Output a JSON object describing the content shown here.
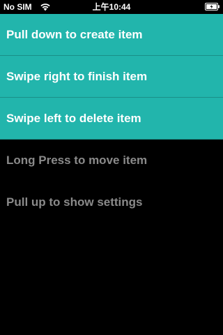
{
  "status_bar": {
    "carrier": "No SIM",
    "time": "上午10:44",
    "wifi_icon": "wifi-icon",
    "battery_icon": "battery-charging-icon"
  },
  "list": {
    "items": [
      {
        "label": "Pull down to create item",
        "state": "highlighted"
      },
      {
        "label": "Swipe right to finish item",
        "state": "highlighted"
      },
      {
        "label": "Swipe left to delete item",
        "state": "highlighted"
      },
      {
        "label": "Long Press to move item",
        "state": "dimmed"
      },
      {
        "label": "Pull up to show settings",
        "state": "dimmed"
      }
    ]
  },
  "colors": {
    "accent": "#22b5ac",
    "background": "#000000",
    "text_active": "#ffffff",
    "text_dimmed": "#8a8a8a"
  }
}
